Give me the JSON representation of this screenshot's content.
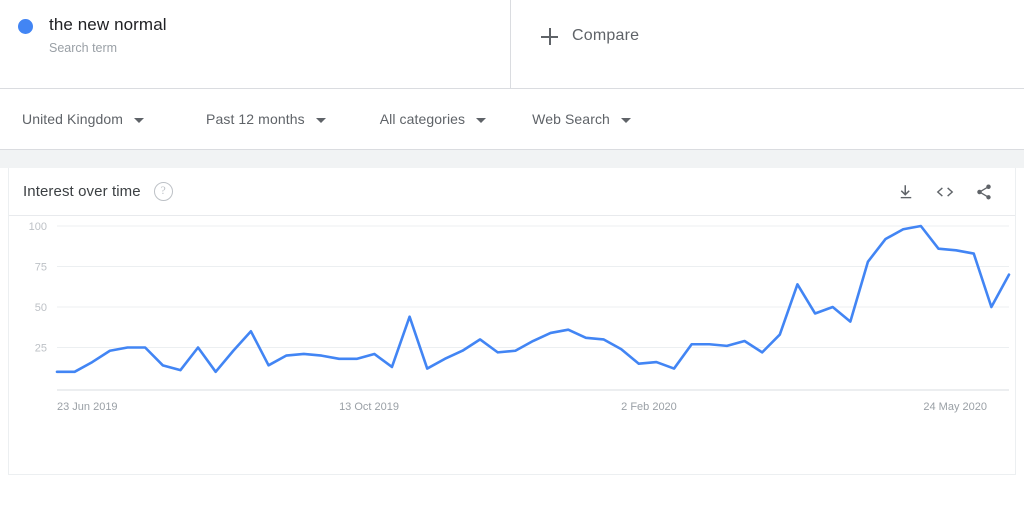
{
  "term": {
    "dot_color": "#4285f4",
    "title": "the new normal",
    "subtitle": "Search term"
  },
  "compare": {
    "label": "Compare",
    "icon": "plus-icon"
  },
  "filters": [
    {
      "label": "United Kingdom"
    },
    {
      "label": "Past 12 months"
    },
    {
      "label": "All categories"
    },
    {
      "label": "Web Search"
    }
  ],
  "card": {
    "title": "Interest over time",
    "help_icon": "?",
    "actions": [
      {
        "name": "download-icon"
      },
      {
        "name": "embed-code-icon"
      },
      {
        "name": "share-icon"
      }
    ]
  },
  "chart_data": {
    "type": "line",
    "title": "Interest over time",
    "xlabel": "",
    "ylabel": "",
    "ylim": [
      0,
      100
    ],
    "yticks": [
      25,
      50,
      75,
      100
    ],
    "grid": true,
    "legend_position": "none",
    "line_color": "#4285f4",
    "xtick_labels": [
      "23 Jun 2019",
      "13 Oct 2019",
      "2 Feb 2020",
      "24 May 2020"
    ],
    "xtick_indices": [
      0,
      16,
      32,
      48
    ],
    "series": [
      {
        "name": "the new normal",
        "color": "#4285f4",
        "values": [
          10,
          10,
          16,
          23,
          25,
          25,
          14,
          11,
          25,
          10,
          23,
          35,
          14,
          20,
          21,
          20,
          18,
          18,
          21,
          13,
          44,
          12,
          18,
          23,
          30,
          22,
          23,
          29,
          34,
          36,
          31,
          30,
          24,
          15,
          16,
          12,
          27,
          27,
          26,
          29,
          22,
          33,
          64,
          46,
          50,
          41,
          78,
          92,
          98,
          100,
          86,
          85,
          83,
          50,
          70
        ]
      }
    ]
  }
}
